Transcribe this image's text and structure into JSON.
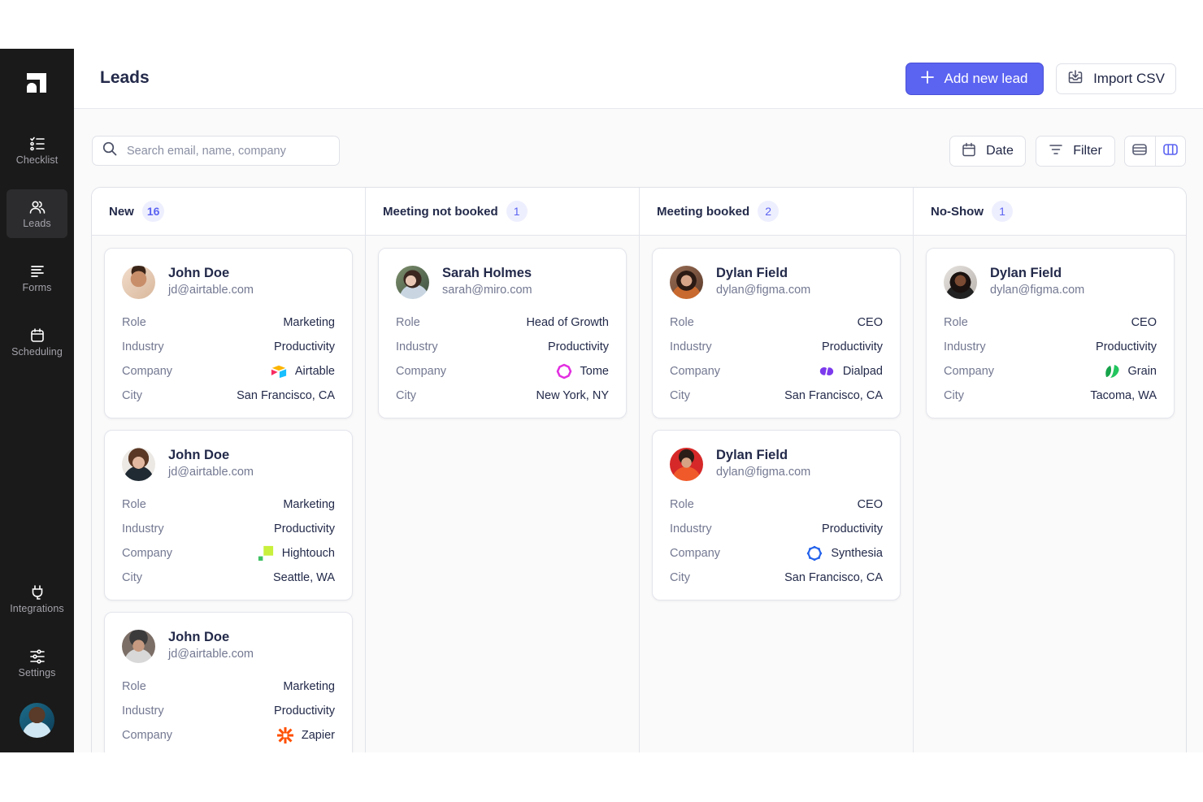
{
  "sidebar": {
    "items": [
      {
        "label": "Checklist",
        "icon": "checklist-icon"
      },
      {
        "label": "Leads",
        "icon": "users-icon",
        "active": true
      },
      {
        "label": "Forms",
        "icon": "forms-icon"
      },
      {
        "label": "Scheduling",
        "icon": "calendar-icon"
      },
      {
        "label": "Integrations",
        "icon": "plug-icon"
      },
      {
        "label": "Settings",
        "icon": "sliders-icon"
      }
    ]
  },
  "header": {
    "title": "Leads",
    "add_button": "Add new lead",
    "import_button": "Import CSV"
  },
  "toolbar": {
    "search_placeholder": "Search email, name, company",
    "search_value": "",
    "date_button": "Date",
    "filter_button": "Filter",
    "view_options": [
      "list-view",
      "board-view"
    ],
    "active_view": "board-view"
  },
  "colors": {
    "accent": "#5b63f1",
    "sidebar_bg": "#1a1a1a",
    "count_badge_bg": "#eeeffe"
  },
  "field_labels": {
    "role": "Role",
    "industry": "Industry",
    "company": "Company",
    "city": "City"
  },
  "columns": [
    {
      "title": "New",
      "count": "16",
      "cards": [
        {
          "name": "John Doe",
          "email": "jd@airtable.com",
          "role": "Marketing",
          "industry": "Productivity",
          "company": "Airtable",
          "company_logo": "airtable-logo-icon",
          "city": "San Francisco, CA"
        },
        {
          "name": "John Doe",
          "email": "jd@airtable.com",
          "role": "Marketing",
          "industry": "Productivity",
          "company": "Hightouch",
          "company_logo": "hightouch-logo-icon",
          "city": "Seattle, WA"
        },
        {
          "name": "John Doe",
          "email": "jd@airtable.com",
          "role": "Marketing",
          "industry": "Productivity",
          "company": "Zapier",
          "company_logo": "zapier-logo-icon",
          "city": ""
        }
      ]
    },
    {
      "title": "Meeting not booked",
      "count": "1",
      "cards": [
        {
          "name": "Sarah Holmes",
          "email": "sarah@miro.com",
          "role": "Head of Growth",
          "industry": "Productivity",
          "company": "Tome",
          "company_logo": "tome-logo-icon",
          "city": "New York, NY"
        }
      ]
    },
    {
      "title": "Meeting booked",
      "count": "2",
      "cards": [
        {
          "name": "Dylan Field",
          "email": "dylan@figma.com",
          "role": "CEO",
          "industry": "Productivity",
          "company": "Dialpad",
          "company_logo": "dialpad-logo-icon",
          "city": "San Francisco, CA"
        },
        {
          "name": "Dylan Field",
          "email": "dylan@figma.com",
          "role": "CEO",
          "industry": "Productivity",
          "company": "Synthesia",
          "company_logo": "synthesia-logo-icon",
          "city": "San Francisco, CA"
        }
      ]
    },
    {
      "title": "No-Show",
      "count": "1",
      "cards": [
        {
          "name": "Dylan Field",
          "email": "dylan@figma.com",
          "role": "CEO",
          "industry": "Productivity",
          "company": "Grain",
          "company_logo": "grain-logo-icon",
          "city": "Tacoma, WA"
        }
      ]
    }
  ]
}
